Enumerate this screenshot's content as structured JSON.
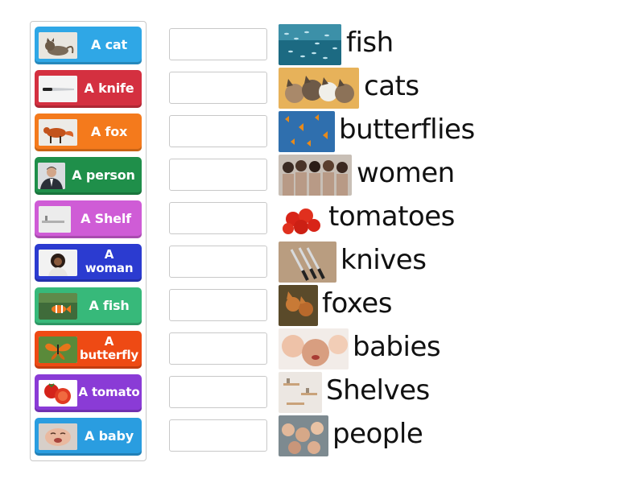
{
  "tiles": [
    {
      "label": "A cat",
      "color": "#2fa7e6",
      "icon": "cat-photo-icon"
    },
    {
      "label": "A knife",
      "color": "#d43040",
      "icon": "knife-photo-icon"
    },
    {
      "label": "A fox",
      "color": "#f47a1c",
      "icon": "fox-photo-icon"
    },
    {
      "label": "A person",
      "color": "#1f8f4a",
      "icon": "person-photo-icon"
    },
    {
      "label": "A Shelf",
      "color": "#cf5cd6",
      "icon": "shelf-photo-icon"
    },
    {
      "label": "A woman",
      "color": "#2b3bd0",
      "icon": "woman-photo-icon"
    },
    {
      "label": "A fish",
      "color": "#37b97a",
      "icon": "fish-photo-icon"
    },
    {
      "label": "A butterfly",
      "color": "#ee4a14",
      "icon": "butterfly-photo-icon"
    },
    {
      "label": "A tomato",
      "color": "#8a3bd6",
      "icon": "tomato-photo-icon"
    },
    {
      "label": "A baby",
      "color": "#2a9de0",
      "icon": "baby-photo-icon"
    }
  ],
  "targets": [
    {
      "word": "fish",
      "icon": "fish-school-photo-icon"
    },
    {
      "word": "cats",
      "icon": "cats-photo-icon"
    },
    {
      "word": "butterflies",
      "icon": "butterflies-photo-icon"
    },
    {
      "word": "women",
      "icon": "women-photo-icon"
    },
    {
      "word": "tomatoes",
      "icon": "tomatoes-photo-icon"
    },
    {
      "word": "knives",
      "icon": "knives-photo-icon"
    },
    {
      "word": "foxes",
      "icon": "foxes-photo-icon"
    },
    {
      "word": "babies",
      "icon": "babies-photo-icon"
    },
    {
      "word": "Shelves",
      "icon": "shelves-photo-icon"
    },
    {
      "word": "people",
      "icon": "people-photo-icon"
    }
  ]
}
